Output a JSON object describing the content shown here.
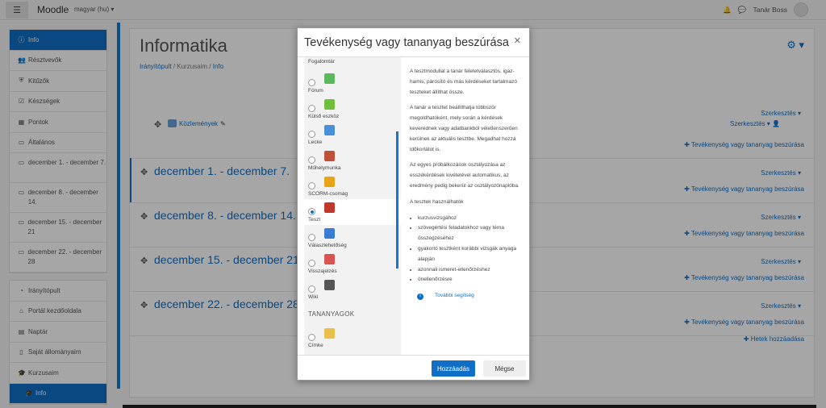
{
  "navbar": {
    "brand": "Moodle",
    "language": "magyar (hu)",
    "user_name": "Tanár Boss"
  },
  "sidebar": {
    "course_items": [
      {
        "label": "Info",
        "icon": "info-icon",
        "active": true
      },
      {
        "label": "Résztvevők",
        "icon": "users-icon"
      },
      {
        "label": "Kitűzők",
        "icon": "shield-icon"
      },
      {
        "label": "Készségek",
        "icon": "check-square-icon"
      },
      {
        "label": "Pontok",
        "icon": "table-icon"
      },
      {
        "label": "Általános",
        "icon": "folder-icon"
      },
      {
        "label": "december 1. - december 7.",
        "icon": "folder-icon",
        "tall": true
      },
      {
        "label": "december 8. - december 14.",
        "icon": "folder-icon",
        "tall": true
      },
      {
        "label": "december 15. - december 21",
        "icon": "folder-icon",
        "tall": true
      },
      {
        "label": "december 22. - december 28",
        "icon": "folder-icon",
        "tall": true
      }
    ],
    "site_items": [
      {
        "label": "Irányítópult",
        "icon": "dashboard-icon"
      },
      {
        "label": "Portál kezdőoldala",
        "icon": "home-icon"
      },
      {
        "label": "Naptár",
        "icon": "calendar-icon"
      },
      {
        "label": "Saját állományaim",
        "icon": "file-icon"
      },
      {
        "label": "Kurzusaim",
        "icon": "graduation-cap-icon"
      },
      {
        "label": "Info",
        "icon": "graduation-cap-icon",
        "active": true,
        "sub": true
      }
    ]
  },
  "main": {
    "title": "Informatika",
    "breadcrumb": [
      "Irányítópult",
      "Kurzusaim",
      "Info"
    ],
    "news_link": "Közlemények",
    "edit_label": "Szerkesztés",
    "add_activity_label": "Tevékenység vagy tananyag beszúrása",
    "add_weeks_label": "Hetek hozzáadása",
    "sections": [
      "december 1. - december 7.",
      "december 8. - december 14.",
      "december 15. - december 21.",
      "december 22. - december 28."
    ]
  },
  "modal": {
    "title": "Tevékenység vagy tananyag beszúrása",
    "top_partial_label": "Fogalomtár",
    "options": [
      {
        "label": "Fórum",
        "icon": "forum-icon",
        "color": "#5cb85c"
      },
      {
        "label": "Külső eszköz",
        "icon": "puzzle-icon",
        "color": "#6fbf3a"
      },
      {
        "label": "Lecke",
        "icon": "lesson-icon",
        "color": "#4a90d9"
      },
      {
        "label": "Műhelymunka",
        "icon": "workshop-icon",
        "color": "#c0503a"
      },
      {
        "label": "SCORM-csomag",
        "icon": "scorm-icon",
        "color": "#e8a317"
      },
      {
        "label": "Teszt",
        "icon": "quiz-icon",
        "color": "#c0392b",
        "selected": true
      },
      {
        "label": "Válaszlehetőség",
        "icon": "choice-icon",
        "color": "#3a7bd5"
      },
      {
        "label": "Visszajelzés",
        "icon": "feedback-icon",
        "color": "#d9534f"
      },
      {
        "label": "Wiki",
        "icon": "wiki-icon",
        "color": "#555555"
      }
    ],
    "resources_heading": "TANANYAGOK",
    "resource_options": [
      {
        "label": "Címke",
        "icon": "label-icon",
        "color": "#e8c04a"
      }
    ],
    "description": {
      "paragraphs": [
        "A tesztmodullal a tanár feleletválasztós, igaz-hamis, párosító és más kérdéseket tartalmazó teszteket állíthat össze.",
        "A tanár a tesztet beállíthatja többször megoldhatóként, mely során a kérdések keverednek vagy adatbankból véletlenszerűen kerülnek az aktuális tesztbe. Megadhat hozzá időkorlátot is.",
        "Az egyes próbálkozások osztályozása az esszékérdések kivételével automatikus, az eredmény pedig bekerül az osztályozónaplóba.",
        "A tesztek használhatók"
      ],
      "uses": [
        "kurzusvizsgához",
        "szövegértési feladatokhoz vagy téma összegzéséhez",
        "gyakorló tesztként korábbi vizsgák anyaga alapján",
        "azonnali ismeret-ellenőrzéshez",
        "önellenőrzésre"
      ],
      "help_link": "További segítség"
    },
    "add_button": "Hozzáadás",
    "cancel_button": "Mégse"
  }
}
